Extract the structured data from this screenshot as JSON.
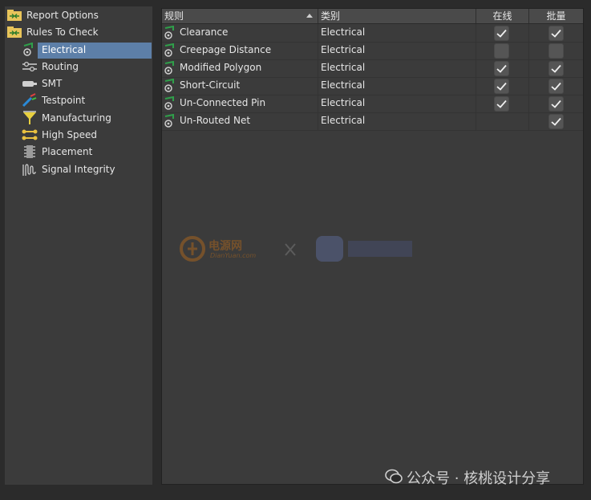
{
  "tree": {
    "items": [
      {
        "label": "Report Options",
        "icon": "folder-rule-icon"
      },
      {
        "label": "Rules To Check",
        "icon": "folder-rule-icon"
      },
      {
        "label": "Electrical",
        "icon": "electrical-icon",
        "selected": true
      },
      {
        "label": "Routing",
        "icon": "routing-icon"
      },
      {
        "label": "SMT",
        "icon": "smt-icon"
      },
      {
        "label": "Testpoint",
        "icon": "testpoint-icon"
      },
      {
        "label": "Manufacturing",
        "icon": "manufacturing-icon"
      },
      {
        "label": "High Speed",
        "icon": "high-speed-icon"
      },
      {
        "label": "Placement",
        "icon": "placement-icon"
      },
      {
        "label": "Signal Integrity",
        "icon": "signal-integrity-icon"
      }
    ]
  },
  "grid": {
    "headers": {
      "rule": "规则",
      "category": "类别",
      "online": "在线",
      "batch": "批量"
    },
    "rows": [
      {
        "rule": "Clearance",
        "category": "Electrical",
        "online": true,
        "batch": true
      },
      {
        "rule": "Creepage Distance",
        "category": "Electrical",
        "online": false,
        "batch": false
      },
      {
        "rule": "Modified Polygon",
        "category": "Electrical",
        "online": true,
        "batch": true
      },
      {
        "rule": "Short-Circuit",
        "category": "Electrical",
        "online": true,
        "batch": true
      },
      {
        "rule": "Un-Connected Pin",
        "category": "Electrical",
        "online": true,
        "batch": true
      },
      {
        "rule": "Un-Routed Net",
        "category": "Electrical",
        "online": null,
        "batch": true
      }
    ]
  },
  "watermark": {
    "logo_text": "电源网",
    "logo_sub": "DianYuan.com",
    "footer_text": "公众号 · 核桃设计分享"
  }
}
